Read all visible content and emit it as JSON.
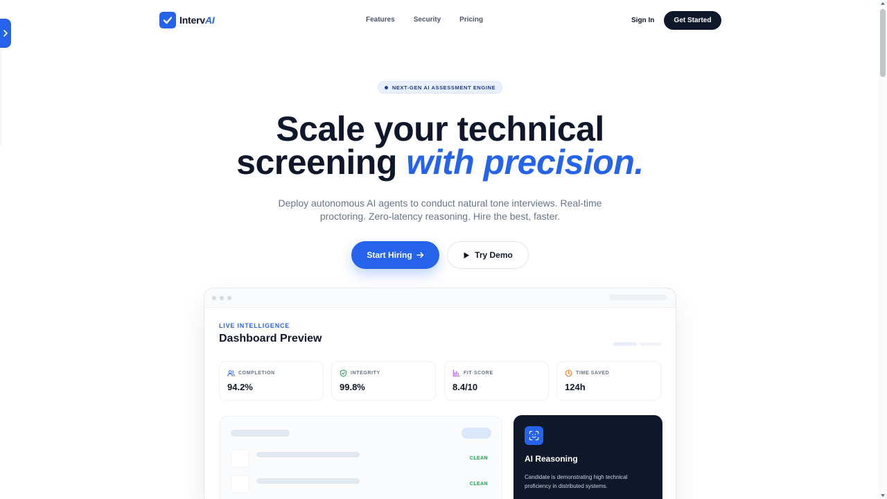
{
  "brand": {
    "name_part": "Interv",
    "name_ai": "AI",
    "accent": "#2563eb",
    "dark": "#0f172a"
  },
  "nav": {
    "links": [
      "Features",
      "Security",
      "Pricing"
    ],
    "sign_in": "Sign In",
    "cta": "Get Started"
  },
  "hero": {
    "badge": "NEXT-GEN AI ASSESSMENT ENGINE",
    "headline_line1": "Scale your technical",
    "headline_line2_plain": "screening ",
    "headline_line2_accent": "with precision.",
    "subtitle_line1": "Deploy autonomous AI agents to conduct natural tone interviews. Real-time",
    "subtitle_line2": "proctoring. Zero-latency reasoning. Hire the best, faster.",
    "primary_button": "Start Hiring",
    "secondary_button": "Try Demo"
  },
  "dashboard": {
    "eyebrow": "LIVE INTELLIGENCE",
    "title": "Dashboard Preview",
    "stats": [
      {
        "label": "COMPLETION",
        "value": "94.2%",
        "icon": "users-icon",
        "color": "#2563eb"
      },
      {
        "label": "INTEGRITY",
        "value": "99.8%",
        "icon": "shield-check-icon",
        "color": "#16a34a"
      },
      {
        "label": "FIT SCORE",
        "value": "8.4/10",
        "icon": "bar-chart-icon",
        "color": "#a855f7"
      },
      {
        "label": "TIME SAVED",
        "value": "124h",
        "icon": "clock-icon",
        "color": "#f97316"
      }
    ],
    "rows": [
      {
        "status": "CLEAN"
      },
      {
        "status": "CLEAN"
      }
    ],
    "ai_panel": {
      "icon": "scan-face-icon",
      "title": "AI Reasoning",
      "body": "Candidate is demonstrating high technical proficiency in distributed systems."
    }
  }
}
